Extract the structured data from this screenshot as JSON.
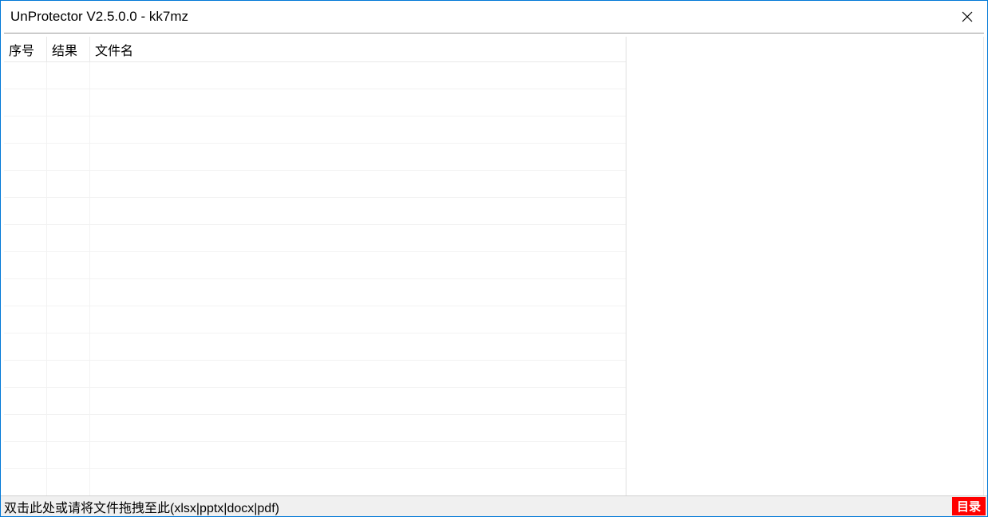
{
  "window": {
    "title": "UnProtector V2.5.0.0 - kk7mz"
  },
  "table": {
    "headers": {
      "seq": "序号",
      "result": "结果",
      "filename": "文件名"
    },
    "rows": []
  },
  "statusbar": {
    "hint": "双击此处或请将文件拖拽至此(xlsx|pptx|docx|pdf)",
    "dir_button": "目录"
  }
}
